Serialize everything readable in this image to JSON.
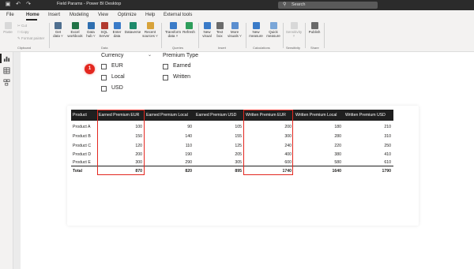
{
  "titlebar": {
    "title": "Field Params - Power BI Desktop",
    "search_placeholder": "Search",
    "icons": [
      "save-icon",
      "undo-icon",
      "redo-icon",
      "search-icon"
    ]
  },
  "menu": {
    "tabs": [
      "File",
      "Home",
      "Insert",
      "Modeling",
      "View",
      "Optimize",
      "Help",
      "External tools"
    ],
    "active": "Home"
  },
  "ribbon": {
    "paste": "Paste",
    "cut": "Cut",
    "copy": "Copy",
    "format_painter": "Format painter",
    "clipboard": "Clipboard",
    "get_data": "Get data ˅",
    "excel_workbook": "Excel workbook",
    "data_hub": "Data hub ˅",
    "sql_server": "SQL Server",
    "enter_data": "Enter data",
    "dataverse": "Dataverse",
    "recent_sources": "Recent sources ˅",
    "data": "Data",
    "transform_data": "Transform data ˅",
    "refresh": "Refresh",
    "queries": "Queries",
    "new_visual": "New visual",
    "text_box": "Text box",
    "more_visuals": "More visuals ˅",
    "insert": "Insert",
    "new_measure": "New measure",
    "quick_measure": "Quick measure",
    "calculations": "Calculations",
    "sensitivity": "Sensitivity ˅",
    "sensitivity_group": "Sensitivity",
    "publish": "Publish",
    "share": "Share"
  },
  "leftnav": {
    "icons": [
      "report-view-icon",
      "table-view-icon",
      "model-view-icon"
    ]
  },
  "slicers": {
    "currency": {
      "title": "Currency",
      "options": [
        "EUR",
        "Local",
        "USD"
      ]
    },
    "premium_type": {
      "title": "Premium Type",
      "options": [
        "Earned",
        "Written"
      ]
    }
  },
  "badge": "1",
  "table": {
    "columns": [
      "Product",
      "Earned Premium EUR",
      "Earned Premium Local",
      "Earned Premium USD",
      "Written Premium EUR",
      "Written Premium Local",
      "Written Premium USD"
    ],
    "rows": [
      [
        "Product A",
        "100",
        "90",
        "105",
        "200",
        "180",
        "210"
      ],
      [
        "Product B",
        "150",
        "140",
        "155",
        "300",
        "280",
        "310"
      ],
      [
        "Product C",
        "120",
        "110",
        "125",
        "240",
        "220",
        "250"
      ],
      [
        "Product D",
        "200",
        "190",
        "205",
        "400",
        "380",
        "410"
      ],
      [
        "Product E",
        "300",
        "290",
        "305",
        "600",
        "580",
        "610"
      ]
    ],
    "total": [
      "Total",
      "870",
      "820",
      "895",
      "1740",
      "1640",
      "1790"
    ]
  },
  "colors": {
    "highlight": "#e3271f",
    "header_bg": "#1f1f1f",
    "titlebar_bg": "#2b2b2b"
  }
}
